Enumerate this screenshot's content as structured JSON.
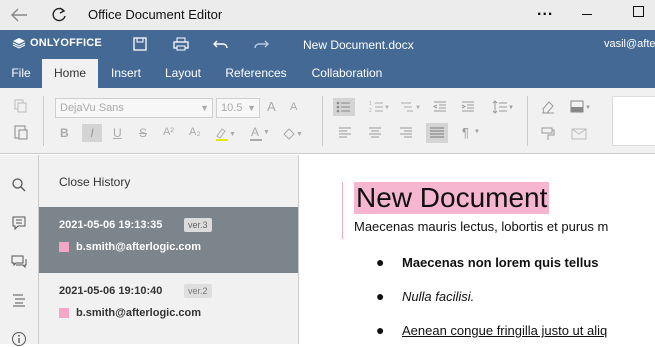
{
  "window": {
    "title": "Office Document Editor",
    "more_label": "..."
  },
  "app": {
    "brand": "ONLYOFFICE",
    "document_name": "New Document.docx",
    "user": "vasil@afte"
  },
  "tabs": [
    "File",
    "Home",
    "Insert",
    "Layout",
    "References",
    "Collaboration"
  ],
  "active_tab": "Home",
  "toolbar": {
    "font_name": "DejaVu Sans",
    "font_size": "10.5",
    "bold": "B",
    "italic": "I",
    "underline": "U",
    "strike": "S",
    "superscript": "A²",
    "subscript": "A₂",
    "paragraph_mark": "¶",
    "grow_font": "A",
    "shrink_font": "A",
    "font_color_letter": "A"
  },
  "history": {
    "close_label": "Close History",
    "items": [
      {
        "date": "2021-05-06 19:13:35",
        "version": "ver.3",
        "user": "b.smith@afterlogic.com",
        "selected": true
      },
      {
        "date": "2021-05-06 19:10:40",
        "version": "ver.2",
        "user": "b.smith@afterlogic.com",
        "selected": false
      }
    ]
  },
  "document": {
    "title": "New Document",
    "paragraph": "Maecenas mauris lectus, lobortis et purus m",
    "bullets": [
      {
        "text": "Maecenas non lorem quis tellus",
        "style": "bold"
      },
      {
        "text": "Nulla facilisi.",
        "style": "italic"
      },
      {
        "text": "Aenean congue fringilla justo ut aliq",
        "style": "underline"
      }
    ]
  },
  "colors": {
    "header_blue": "#446995",
    "selected_history": "#7d858c",
    "author_highlight": "#f7b6cf"
  }
}
